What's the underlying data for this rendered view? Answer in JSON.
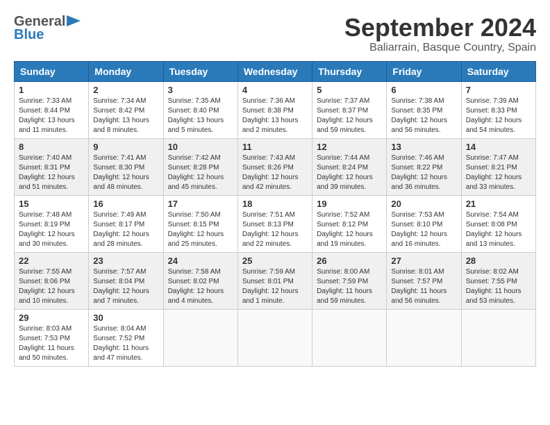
{
  "header": {
    "logo_general": "General",
    "logo_blue": "Blue",
    "month_title": "September 2024",
    "subtitle": "Baliarrain, Basque Country, Spain"
  },
  "weekdays": [
    "Sunday",
    "Monday",
    "Tuesday",
    "Wednesday",
    "Thursday",
    "Friday",
    "Saturday"
  ],
  "weeks": [
    [
      {
        "day": "1",
        "info": "Sunrise: 7:33 AM\nSunset: 8:44 PM\nDaylight: 13 hours and 11 minutes."
      },
      {
        "day": "2",
        "info": "Sunrise: 7:34 AM\nSunset: 8:42 PM\nDaylight: 13 hours and 8 minutes."
      },
      {
        "day": "3",
        "info": "Sunrise: 7:35 AM\nSunset: 8:40 PM\nDaylight: 13 hours and 5 minutes."
      },
      {
        "day": "4",
        "info": "Sunrise: 7:36 AM\nSunset: 8:38 PM\nDaylight: 13 hours and 2 minutes."
      },
      {
        "day": "5",
        "info": "Sunrise: 7:37 AM\nSunset: 8:37 PM\nDaylight: 12 hours and 59 minutes."
      },
      {
        "day": "6",
        "info": "Sunrise: 7:38 AM\nSunset: 8:35 PM\nDaylight: 12 hours and 56 minutes."
      },
      {
        "day": "7",
        "info": "Sunrise: 7:39 AM\nSunset: 8:33 PM\nDaylight: 12 hours and 54 minutes."
      }
    ],
    [
      {
        "day": "8",
        "info": "Sunrise: 7:40 AM\nSunset: 8:31 PM\nDaylight: 12 hours and 51 minutes."
      },
      {
        "day": "9",
        "info": "Sunrise: 7:41 AM\nSunset: 8:30 PM\nDaylight: 12 hours and 48 minutes."
      },
      {
        "day": "10",
        "info": "Sunrise: 7:42 AM\nSunset: 8:28 PM\nDaylight: 12 hours and 45 minutes."
      },
      {
        "day": "11",
        "info": "Sunrise: 7:43 AM\nSunset: 8:26 PM\nDaylight: 12 hours and 42 minutes."
      },
      {
        "day": "12",
        "info": "Sunrise: 7:44 AM\nSunset: 8:24 PM\nDaylight: 12 hours and 39 minutes."
      },
      {
        "day": "13",
        "info": "Sunrise: 7:46 AM\nSunset: 8:22 PM\nDaylight: 12 hours and 36 minutes."
      },
      {
        "day": "14",
        "info": "Sunrise: 7:47 AM\nSunset: 8:21 PM\nDaylight: 12 hours and 33 minutes."
      }
    ],
    [
      {
        "day": "15",
        "info": "Sunrise: 7:48 AM\nSunset: 8:19 PM\nDaylight: 12 hours and 30 minutes."
      },
      {
        "day": "16",
        "info": "Sunrise: 7:49 AM\nSunset: 8:17 PM\nDaylight: 12 hours and 28 minutes."
      },
      {
        "day": "17",
        "info": "Sunrise: 7:50 AM\nSunset: 8:15 PM\nDaylight: 12 hours and 25 minutes."
      },
      {
        "day": "18",
        "info": "Sunrise: 7:51 AM\nSunset: 8:13 PM\nDaylight: 12 hours and 22 minutes."
      },
      {
        "day": "19",
        "info": "Sunrise: 7:52 AM\nSunset: 8:12 PM\nDaylight: 12 hours and 19 minutes."
      },
      {
        "day": "20",
        "info": "Sunrise: 7:53 AM\nSunset: 8:10 PM\nDaylight: 12 hours and 16 minutes."
      },
      {
        "day": "21",
        "info": "Sunrise: 7:54 AM\nSunset: 8:08 PM\nDaylight: 12 hours and 13 minutes."
      }
    ],
    [
      {
        "day": "22",
        "info": "Sunrise: 7:55 AM\nSunset: 8:06 PM\nDaylight: 12 hours and 10 minutes."
      },
      {
        "day": "23",
        "info": "Sunrise: 7:57 AM\nSunset: 8:04 PM\nDaylight: 12 hours and 7 minutes."
      },
      {
        "day": "24",
        "info": "Sunrise: 7:58 AM\nSunset: 8:02 PM\nDaylight: 12 hours and 4 minutes."
      },
      {
        "day": "25",
        "info": "Sunrise: 7:59 AM\nSunset: 8:01 PM\nDaylight: 12 hours and 1 minute."
      },
      {
        "day": "26",
        "info": "Sunrise: 8:00 AM\nSunset: 7:59 PM\nDaylight: 11 hours and 59 minutes."
      },
      {
        "day": "27",
        "info": "Sunrise: 8:01 AM\nSunset: 7:57 PM\nDaylight: 11 hours and 56 minutes."
      },
      {
        "day": "28",
        "info": "Sunrise: 8:02 AM\nSunset: 7:55 PM\nDaylight: 11 hours and 53 minutes."
      }
    ],
    [
      {
        "day": "29",
        "info": "Sunrise: 8:03 AM\nSunset: 7:53 PM\nDaylight: 11 hours and 50 minutes."
      },
      {
        "day": "30",
        "info": "Sunrise: 8:04 AM\nSunset: 7:52 PM\nDaylight: 11 hours and 47 minutes."
      },
      null,
      null,
      null,
      null,
      null
    ]
  ]
}
